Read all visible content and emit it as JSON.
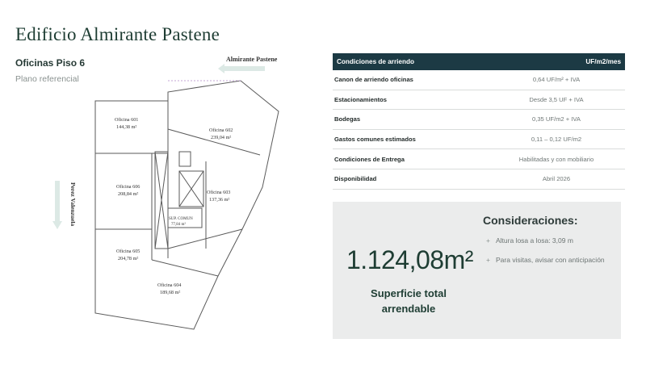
{
  "header": {
    "title": "Edificio Almirante Pastene",
    "subtitle": "Oficinas Piso 6",
    "caption": "Plano referencial"
  },
  "plan": {
    "street_top": "Almirante Pastene",
    "street_left": "Perez Valenzuela",
    "offices": [
      {
        "name": "Oficina 601",
        "area": "144,38 m²"
      },
      {
        "name": "Oficina 602",
        "area": "239,04 m²"
      },
      {
        "name": "Oficina 603",
        "area": "137,36 m²"
      },
      {
        "name": "Oficina 604",
        "area": "189,68 m²"
      },
      {
        "name": "Oficina 605",
        "area": "204,78 m²"
      },
      {
        "name": "Oficina 606",
        "area": "208,84 m²"
      }
    ],
    "common_label": "SUP. COMUN",
    "common_area": "77,84 m²"
  },
  "table": {
    "header_left": "Condiciones de arriendo",
    "header_right": "UF/m2/mes",
    "rows": [
      {
        "label": "Canon de arriendo oficinas",
        "value": "0,64 UF/m² + IVA"
      },
      {
        "label": "Estacionamientos",
        "value": "Desde 3,5 UF + IVA"
      },
      {
        "label": "Bodegas",
        "value": "0,35 UF/m2 + IVA"
      },
      {
        "label": "Gastos comunes estimados",
        "value": "0,11 – 0,12 UF/m2"
      },
      {
        "label": "Condiciones de Entrega",
        "value": "Habilitadas y con mobiliario"
      },
      {
        "label": "Disponibilidad",
        "value": "Abril 2026"
      }
    ]
  },
  "summary": {
    "total_area": "1.124,08m²",
    "total_label": "Superficie total arrendable",
    "considerations_title": "Consideraciones:",
    "considerations": [
      "Altura losa a losa: 3,09 m",
      "Para visitas, avisar con anticipación"
    ]
  },
  "colors": {
    "brand_green": "#1e3d33",
    "table_header": "#1c3a44",
    "arrow_fill": "#dce9e5"
  }
}
